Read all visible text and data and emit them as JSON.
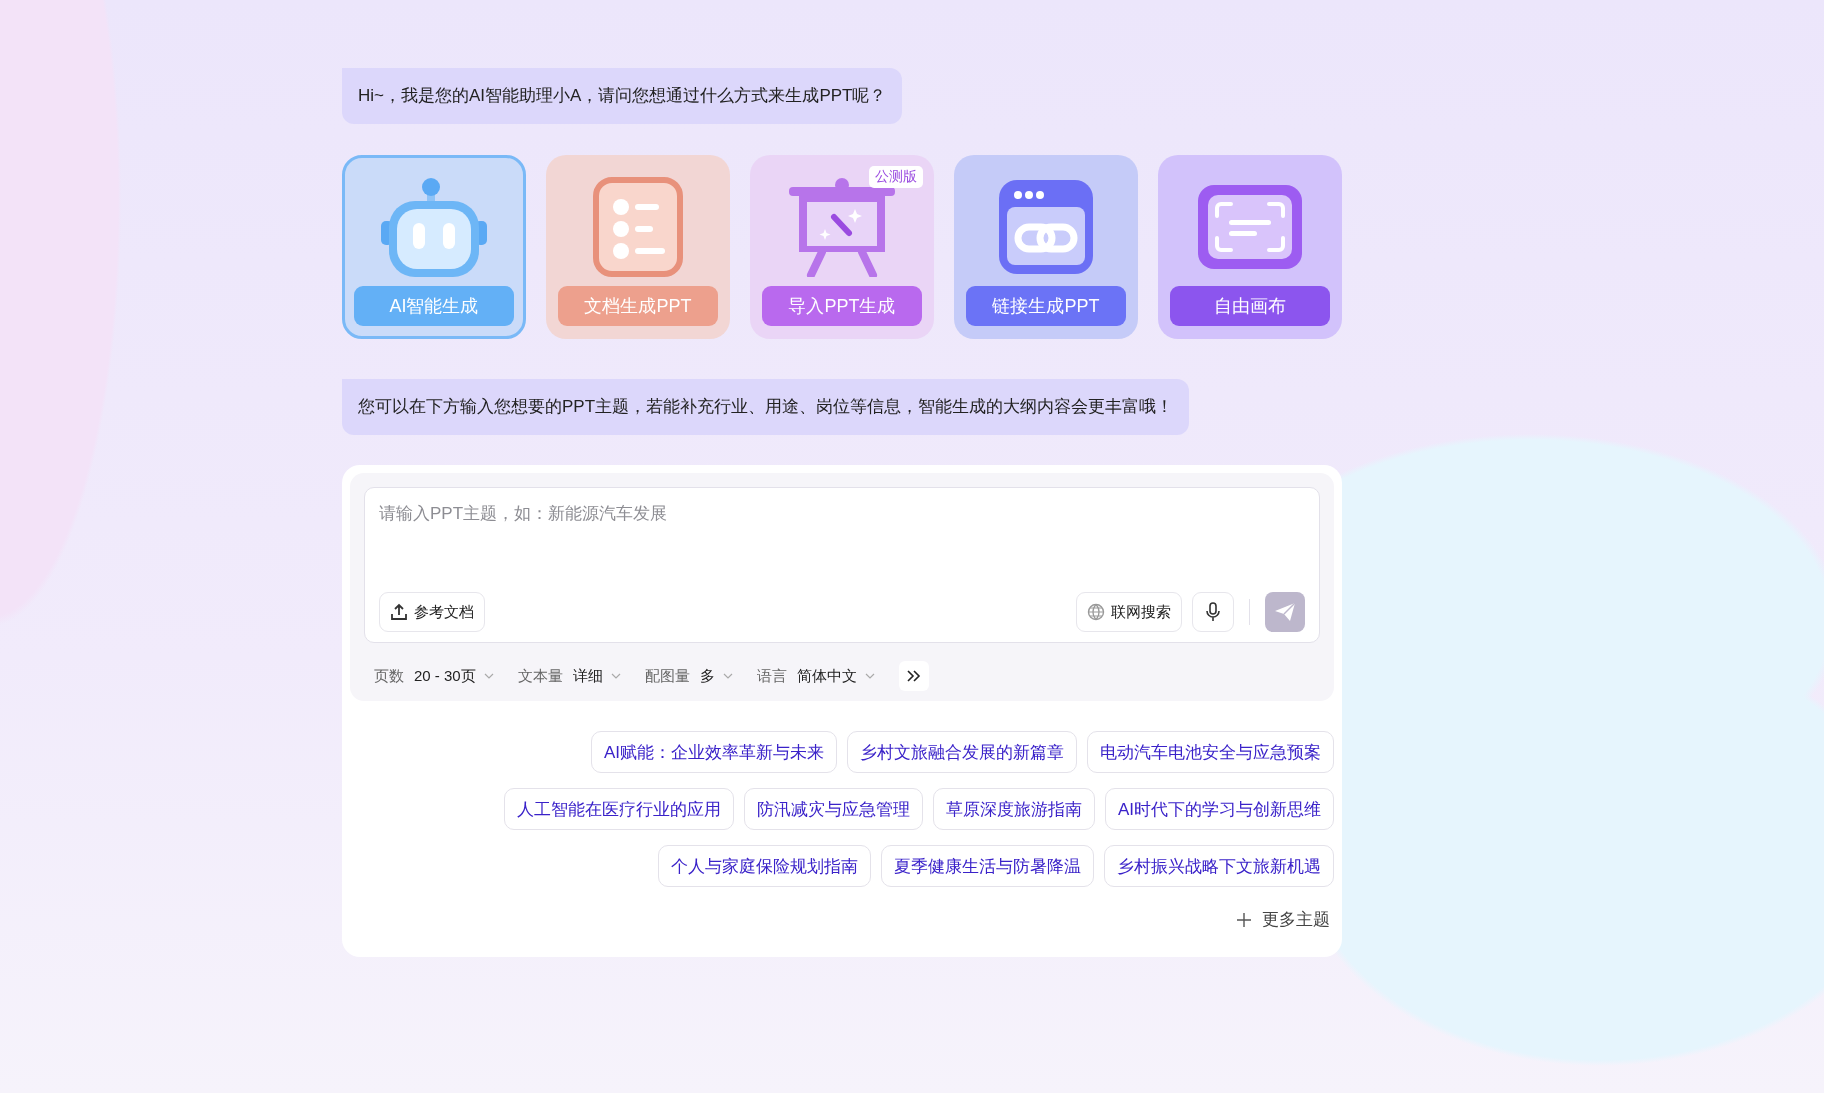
{
  "greeting": "Hi~，我是您的AI智能助理小A，请问您想通过什么方式来生成PPT呢？",
  "modes": [
    {
      "kind": "robot",
      "label": "AI智能生成",
      "selected": true
    },
    {
      "kind": "document",
      "label": "文档生成PPT",
      "selected": false
    },
    {
      "kind": "easel",
      "label": "导入PPT生成",
      "selected": false,
      "badge": "公测版"
    },
    {
      "kind": "link",
      "label": "链接生成PPT",
      "selected": false
    },
    {
      "kind": "canvas",
      "label": "自由画布",
      "selected": false
    }
  ],
  "hint": "您可以在下方输入您想要的PPT主题，若能补充行业、用途、岗位等信息，智能生成的大纲内容会更丰富哦！",
  "input": {
    "placeholder": "请输入PPT主题，如：新能源汽车发展",
    "upload_label": "参考文档",
    "web_search_label": "联网搜索",
    "web_search_on": false
  },
  "options": [
    {
      "label": "页数",
      "value": "20 - 30页"
    },
    {
      "label": "文本量",
      "value": "详细"
    },
    {
      "label": "配图量",
      "value": "多"
    },
    {
      "label": "语言",
      "value": "简体中文"
    }
  ],
  "topic_rows": [
    [
      "AI赋能：企业效率革新与未来",
      "乡村文旅融合发展的新篇章",
      "电动汽车电池安全与应急预案"
    ],
    [
      "人工智能在医疗行业的应用",
      "防汛减灾与应急管理",
      "草原深度旅游指南",
      "AI时代下的学习与创新思维"
    ],
    [
      "个人与家庭保险规划指南",
      "夏季健康生活与防暑降温",
      "乡村振兴战略下文旅新机遇"
    ]
  ],
  "more_topics": "更多主题"
}
